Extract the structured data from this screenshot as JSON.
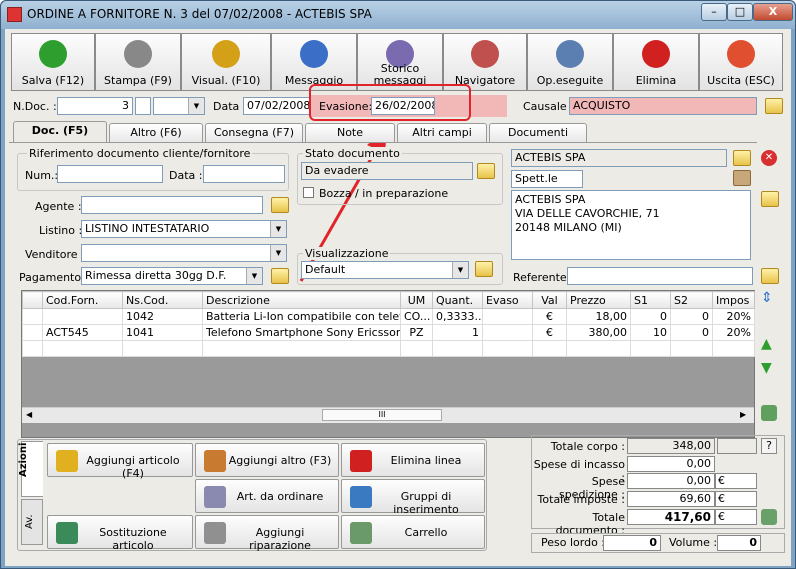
{
  "window": {
    "title": "ORDINE A FORNITORE N. 3  del 07/02/2008 - ACTEBIS SPA",
    "min": "–",
    "max": "□",
    "close": "X"
  },
  "toolbar": [
    {
      "label": "Salva (F12)",
      "icon": "check-icon",
      "color": "#2e9e2e"
    },
    {
      "label": "Stampa (F9)",
      "icon": "printer-icon",
      "color": "#888888"
    },
    {
      "label": "Visual. (F10)",
      "icon": "magic-wand-icon",
      "color": "#d4a017"
    },
    {
      "label": "Messaggio",
      "icon": "message-icon",
      "color": "#3a6ec7"
    },
    {
      "label": "Storico messaggi",
      "icon": "message-history-icon",
      "color": "#7a6ab0"
    },
    {
      "label": "Navigatore",
      "icon": "compass-icon",
      "color": "#c0504d"
    },
    {
      "label": "Op.eseguite",
      "icon": "gears-icon",
      "color": "#5a7fb0"
    },
    {
      "label": "Elimina",
      "icon": "delete-x-icon",
      "color": "#d02020"
    },
    {
      "label": "Uscita (ESC)",
      "icon": "exit-icon",
      "color": "#e05030"
    }
  ],
  "header": {
    "ndoc_label": "N.Doc. :",
    "ndoc_value": "3",
    "data_label": "Data :",
    "data_value": "07/02/2008",
    "evasione_label": "Evasione:",
    "evasione_value": "26/02/2008",
    "causale_label": "Causale :",
    "causale_value": "ACQUISTO"
  },
  "tabs": [
    "Doc. (F5)",
    "Altro (F6)",
    "Consegna (F7)",
    "Note",
    "Altri campi",
    "Documenti"
  ],
  "rif": {
    "title": "Riferimento documento cliente/fornitore",
    "num_label": "Num.:",
    "data_label": "Data :"
  },
  "left": {
    "agente_label": "Agente :",
    "listino_label": "Listino :",
    "listino_value": "LISTINO INTESTATARIO",
    "venditore_label": "Venditore :",
    "pagamento_label": "Pagamento :",
    "pagamento_value": "Rimessa diretta 30gg D.F."
  },
  "stato": {
    "title": "Stato documento",
    "value": "Da evadere",
    "bozza_label": "Bozza / in preparazione"
  },
  "visual": {
    "title": "Visualizzazione",
    "value": "Default"
  },
  "supplier": {
    "name": "ACTEBIS SPA",
    "spett": "Spett.le",
    "address": [
      "ACTEBIS SPA",
      "VIA DELLE CAVORCHIE, 71",
      "20148 MILANO (MI)"
    ],
    "referente_label": "Referente"
  },
  "grid": {
    "headers": [
      "Cod.Forn.",
      "Ns.Cod.",
      "Descrizione",
      "UM",
      "Quant.",
      "Evaso",
      "Val",
      "Prezzo",
      "S1",
      "S2",
      "Impos"
    ],
    "rows": [
      [
        "",
        "1042",
        "Batteria Li-Ion compatibile con telefoni ...",
        "CO...",
        "0,3333...",
        "",
        "€",
        "18,00",
        "0",
        "0",
        "20%"
      ],
      [
        "ACT545",
        "1041",
        "Telefono Smartphone Sony Ericsson P...",
        "PZ",
        "1",
        "",
        "€",
        "380,00",
        "10",
        "0",
        "20%"
      ]
    ],
    "scroll_mark": "III"
  },
  "side_tabs": [
    "Azioni",
    "Av."
  ],
  "actions": [
    {
      "label": "Aggiungi articolo (F4)",
      "icon": "add-article-icon"
    },
    {
      "label": "Aggiungi altro (F3)",
      "icon": "add-other-icon"
    },
    {
      "label": "Elimina linea",
      "icon": "delete-line-icon"
    },
    {
      "label": "Art. da ordinare",
      "icon": "order-items-icon"
    },
    {
      "label": "Gruppi di inserimento",
      "icon": "insert-groups-icon"
    },
    {
      "label": "Sostituzione articolo",
      "icon": "replace-article-icon"
    },
    {
      "label": "Aggiungi riparazione",
      "icon": "repair-icon"
    },
    {
      "label": "Carrello",
      "icon": "cart-icon"
    }
  ],
  "totals": {
    "totale_corpo_label": "Totale corpo :",
    "totale_corpo": "348,00",
    "help": "?",
    "spese_incasso_label": "Spese di incasso :",
    "spese_incasso": "0,00",
    "spese_spedizione_label": "Spese spedizione :",
    "spese_spedizione": "0,00",
    "currency": "€",
    "totale_imposte_label": "Totale imposte :",
    "totale_imposte": "69,60",
    "totale_documento_label": "Totale documento :",
    "totale_documento": "417,60",
    "peso_label": "Peso lordo :",
    "peso": "0",
    "volume_label": "Volume :",
    "volume": "0"
  },
  "colors": {
    "annotation": "#e0242a",
    "evasione_bg": "#f2b8b8",
    "causale_bg": "#f2b8b8"
  }
}
